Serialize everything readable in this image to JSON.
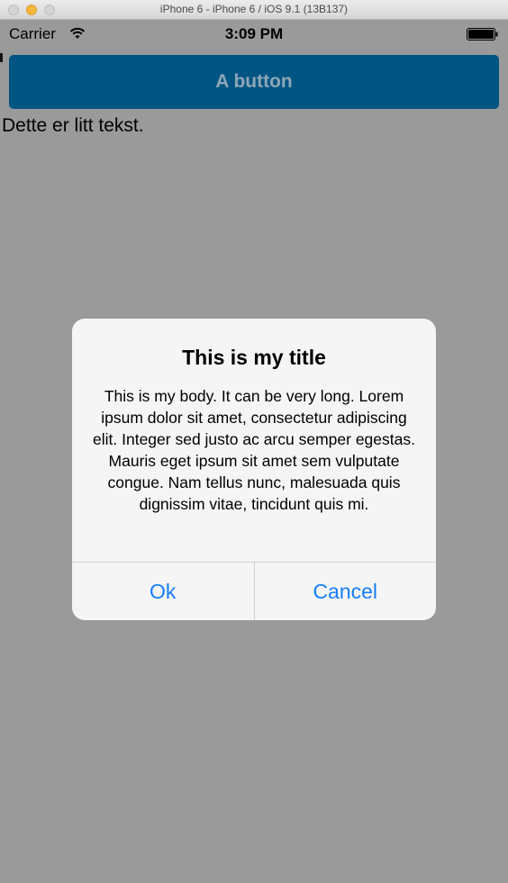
{
  "window": {
    "title": "iPhone 6 - iPhone 6 / iOS 9.1 (13B137)"
  },
  "statusbar": {
    "carrier": "Carrier",
    "time": "3:09 PM",
    "wifi_icon": "wifi-icon",
    "battery_icon": "battery-icon"
  },
  "main": {
    "button_label": "A button",
    "text": "Dette er litt tekst."
  },
  "alert": {
    "title": "This is my title",
    "message": "This is my body. It can be very long. Lorem ipsum dolor sit amet, consectetur adipiscing elit. Integer sed justo ac arcu semper egestas. Mauris eget ipsum sit amet sem vulputate congue. Nam tellus nunc, malesuada quis dignissim vitae, tincidunt quis mi.",
    "ok_label": "Ok",
    "cancel_label": "Cancel"
  },
  "colors": {
    "button_bg": "#005583",
    "alert_action": "#157efb",
    "overlay": "#9a9a9a"
  }
}
